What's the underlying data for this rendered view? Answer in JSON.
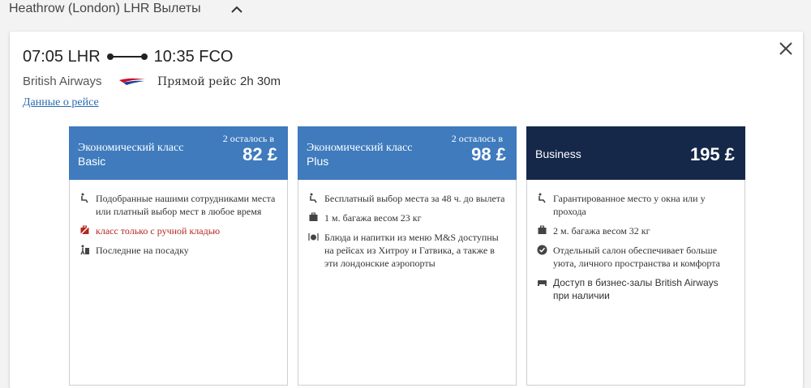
{
  "header": {
    "title": "Heathrow (London) LHR Вылеты"
  },
  "flight": {
    "depart_time": "07:05",
    "depart_code": "LHR",
    "arrive_time": "10:35",
    "arrive_code": "FCO",
    "airline": "British Airways",
    "direct_label": "Прямой рейс",
    "duration": "2h 30m",
    "details_link": "Данные о рейсе"
  },
  "colors": {
    "basic": "#3f7bbd",
    "plus": "#3f7bbd",
    "business": "#15284a",
    "link": "#2a6bb0",
    "warning": "#b3261e"
  },
  "fares": [
    {
      "remaining": "2 осталось в",
      "class_name": "Экономический класс",
      "sub": "Basic",
      "price": "82 £",
      "features": [
        {
          "icon": "seat-icon",
          "text": "Подобранные нашими сотрудниками места или платный выбор мест в любое время"
        },
        {
          "icon": "no-bag-icon",
          "text": "класс только с ручной кладью",
          "warning": true
        },
        {
          "icon": "boarding-icon",
          "text": "Последние на посадку"
        }
      ]
    },
    {
      "remaining": "2 осталось в",
      "class_name": "Экономический класс",
      "sub": "Plus",
      "price": "98 £",
      "features": [
        {
          "icon": "seat-icon",
          "text": "Бесплатный выбор места за 48 ч. до вылета"
        },
        {
          "icon": "bag-icon",
          "text": "1 м. багажа весом 23 кг"
        },
        {
          "icon": "meal-icon",
          "text": "Блюда и напитки из меню M&S доступны на рейсах из Хитроу и Гатвика, а также в эти лондонские аэропорты"
        }
      ]
    },
    {
      "remaining": "",
      "class_name": "",
      "sub": "Business",
      "price": "195 £",
      "features": [
        {
          "icon": "seat-icon",
          "text": "Гарантированное место у окна или у прохода"
        },
        {
          "icon": "bag-icon",
          "text": "2 м. багажа весом 32 кг"
        },
        {
          "icon": "check-icon",
          "text": "Отдельный салон обеспечивает больше уюта, личного пространства и комфорта"
        },
        {
          "icon": "lounge-icon",
          "text": "Доступ в бизнес-залы British Airways при наличии"
        }
      ]
    }
  ]
}
